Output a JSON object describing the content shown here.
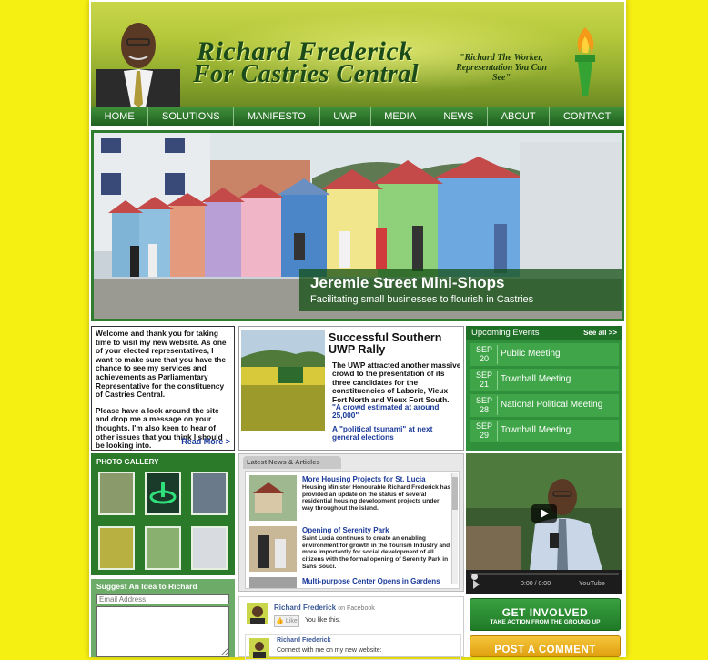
{
  "colors": {
    "background": "#f6ef12",
    "nav": "#2f7d2f",
    "events": "#2f8f3a",
    "link": "#1a3a9a",
    "facebook": "#3b5998",
    "post_comment": "#e8ac20"
  },
  "header": {
    "title_line1": "Richard Frederick",
    "title_line2": "For Castries Central",
    "slogan": "\"Richard The Worker, Representation You Can See\""
  },
  "nav": {
    "items": [
      "HOME",
      "SOLUTIONS",
      "MANIFESTO",
      "UWP",
      "MEDIA",
      "NEWS",
      "ABOUT",
      "CONTACT"
    ]
  },
  "hero": {
    "headline": "Jeremie Street Mini-Shops",
    "subtitle": "Facilitating small businesses to flourish in Castries"
  },
  "welcome": {
    "para1": "Welcome and thank you for taking time to visit my new website. As one of your elected representatives, I want to make sure that you have the chance to see my services and achievements as Parliamentary Representative for the constituency of Castries Central.",
    "para2": "Please have a look around the site and drop me a message on your thoughts. I'm also keen to hear of other issues that you think I should be looking into.",
    "read_more": "Read More >"
  },
  "rally": {
    "headline": "Successful Southern UWP Rally",
    "body": "The UWP attracted another massive crowd to the presentation of its three candidates for the constituencies of Laborie, Vieux Fort North and Vieux Fort South.",
    "quote1": "\"A crowd estimated at around 25,000\"",
    "quote2": "A \"political tsunami\" at next general elections"
  },
  "events": {
    "title": "Upcoming Events",
    "see_all": "See all >>",
    "items": [
      {
        "month": "SEP",
        "day": "20",
        "name": "Public Meeting"
      },
      {
        "month": "SEP",
        "day": "21",
        "name": "Townhall Meeting"
      },
      {
        "month": "SEP",
        "day": "28",
        "name": "National Political Meeting"
      },
      {
        "month": "SEP",
        "day": "29",
        "name": "Townhall Meeting"
      }
    ]
  },
  "gallery": {
    "title": "PHOTO GALLERY"
  },
  "suggest": {
    "title": "Suggest An Idea to Richard",
    "email_placeholder": "Email Address"
  },
  "news": {
    "tab": "Latest News & Articles",
    "items": [
      {
        "title": "More Housing Projects for St. Lucia",
        "body": "Housing Minister Honourable Richard Frederick has provided an update on the status of several residential housing development projects under way throughout the island."
      },
      {
        "title": "Opening of Serenity Park",
        "body": "Saint Lucia continues to create an enabling environment for growth in the Tourism Industry and more importantly for social development of all citizens with the formal opening of Serenity Park in Sans Souci."
      },
      {
        "title": "Multi-purpose Center Opens in Gardens",
        "body": ""
      }
    ]
  },
  "facebook": {
    "name": "Richard Frederick",
    "on": "on Facebook",
    "like": "Like",
    "likes_this": "You like this.",
    "post_name": "Richard Frederick",
    "post_text": "Connect with me on my new website:"
  },
  "video": {
    "time": "0:00 / 0:00",
    "brand": "YouTube"
  },
  "buttons": {
    "get_involved": "GET INVOLVED",
    "get_involved_sub": "TAKE ACTION FROM THE GROUND UP",
    "post_comment": "POST A COMMENT"
  }
}
